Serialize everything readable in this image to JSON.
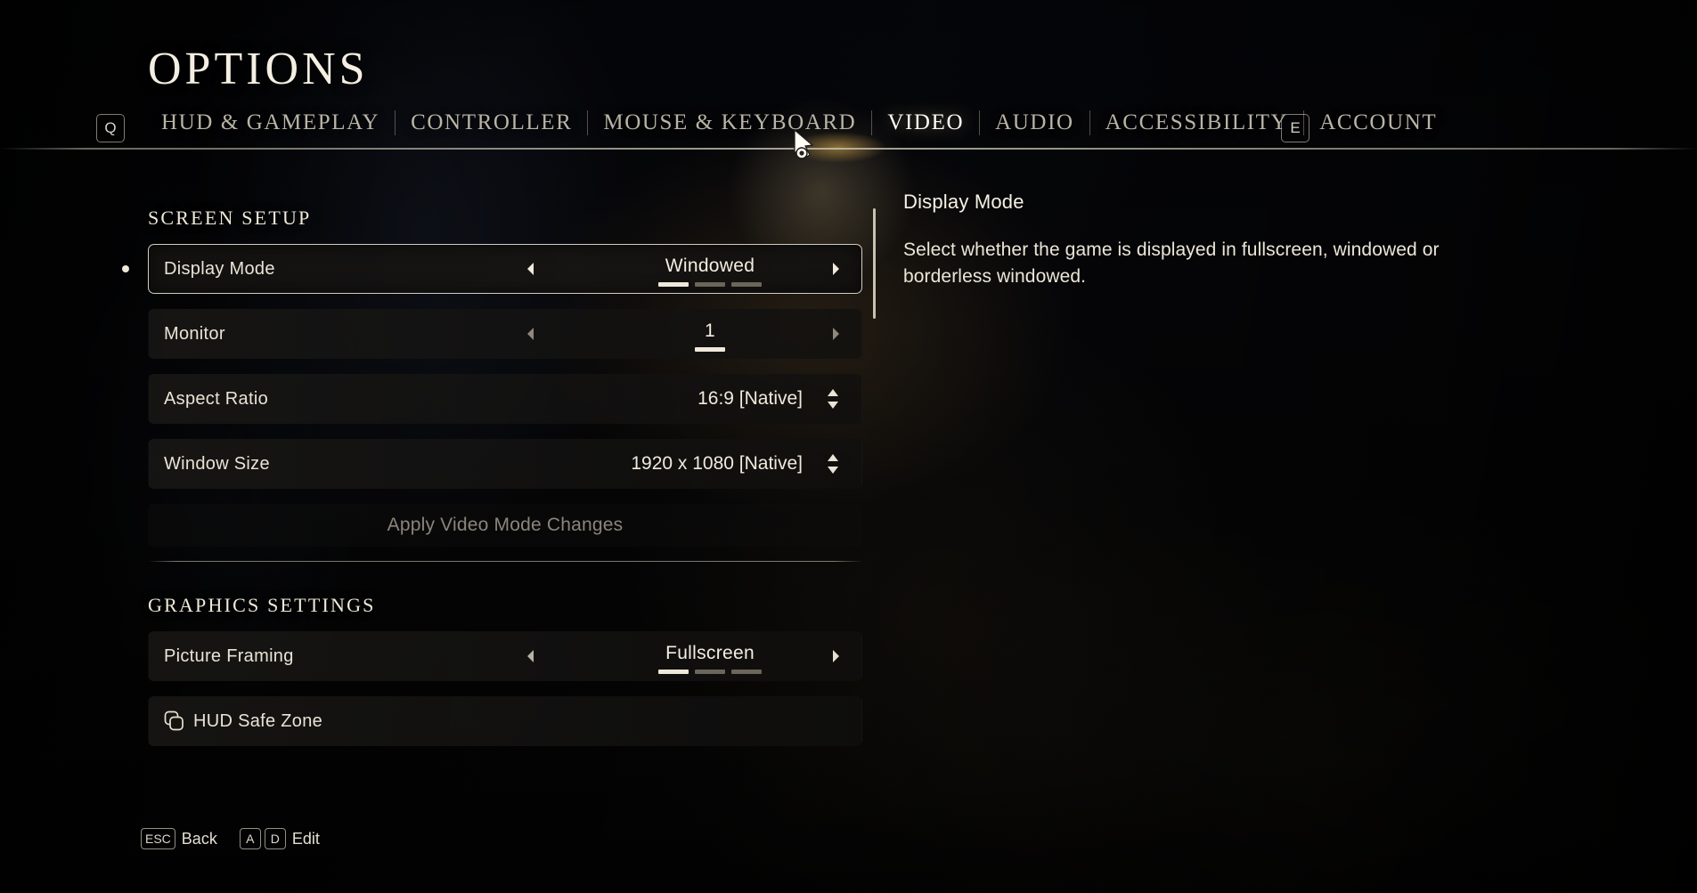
{
  "page_title": "OPTIONS",
  "tabbar": {
    "prev_key": "Q",
    "next_key": "E",
    "tabs": [
      {
        "label": "HUD & GAMEPLAY",
        "active": false
      },
      {
        "label": "CONTROLLER",
        "active": false
      },
      {
        "label": "MOUSE & KEYBOARD",
        "active": false
      },
      {
        "label": "VIDEO",
        "active": true
      },
      {
        "label": "AUDIO",
        "active": false
      },
      {
        "label": "ACCESSIBILITY",
        "active": false
      },
      {
        "label": "ACCOUNT",
        "active": false
      }
    ]
  },
  "sections": {
    "screen_setup": {
      "title": "SCREEN SETUP",
      "rows": {
        "display_mode": {
          "label": "Display Mode",
          "value": "Windowed",
          "segments_total": 3,
          "segment_index": 1,
          "selected": true
        },
        "monitor": {
          "label": "Monitor",
          "value": "1",
          "segments_total": 1,
          "segment_index": 1,
          "selected": false
        },
        "aspect_ratio": {
          "label": "Aspect Ratio",
          "value": "16:9 [Native]"
        },
        "window_size": {
          "label": "Window Size",
          "value": "1920 x 1080 [Native]"
        }
      },
      "apply_button": "Apply Video Mode Changes"
    },
    "graphics_settings": {
      "title": "GRAPHICS SETTINGS",
      "rows": {
        "picture_framing": {
          "label": "Picture Framing",
          "value": "Fullscreen",
          "segments_total": 3,
          "segment_index": 1
        },
        "hud_safe_zone": {
          "label": "HUD Safe Zone"
        }
      }
    }
  },
  "description": {
    "title": "Display Mode",
    "body": "Select whether the game is displayed in fullscreen, windowed or borderless windowed."
  },
  "footer": {
    "back": {
      "key": "ESC",
      "label": "Back"
    },
    "edit": {
      "key_left": "A",
      "key_right": "D",
      "label": "Edit"
    }
  },
  "colors": {
    "accent_cream": "#efe9da",
    "text_primary": "#ece6d8",
    "text_dim": "#8a857c",
    "segment_off": "#6b655a",
    "tab_glow": "#e2b04e"
  }
}
